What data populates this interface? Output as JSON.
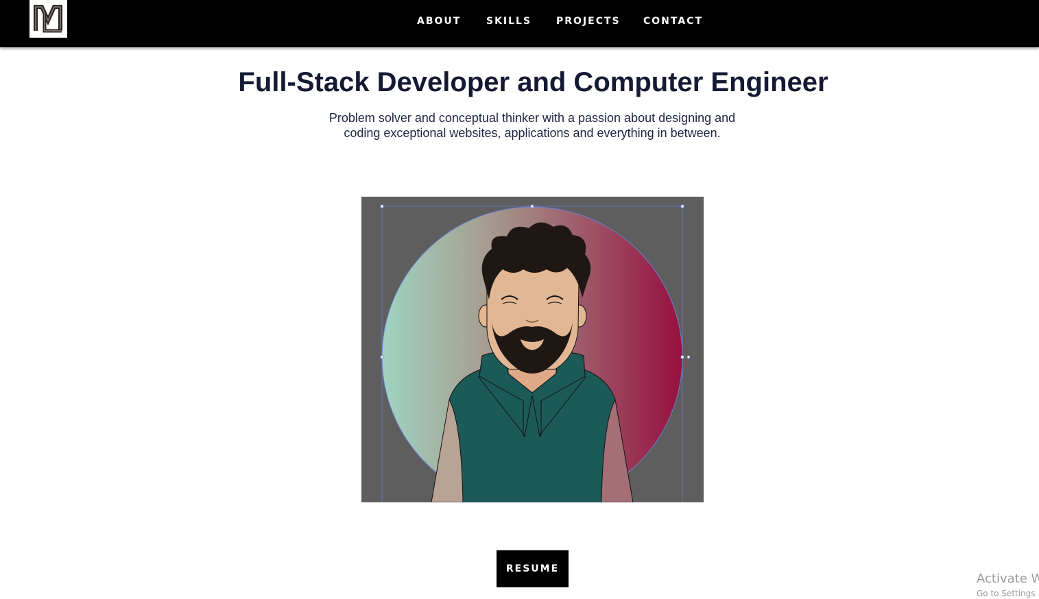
{
  "nav": {
    "logo_alt": "ML logo",
    "items": [
      {
        "label": "ABOUT"
      },
      {
        "label": "SKILLS"
      },
      {
        "label": "PROJECTS"
      },
      {
        "label": "CONTACT"
      }
    ]
  },
  "hero": {
    "title": "Full-Stack Developer and Computer Engineer",
    "subtitle_line1": "Problem solver and conceptual thinker with a passion about designing and",
    "subtitle_line2": "coding exceptional websites, applications and everything in between."
  },
  "avatar": {
    "icon": "avatar-illustration",
    "bg_color": "#5e5e5e",
    "gradient_left": "#9fd3c1",
    "gradient_right": "#970f3f",
    "hoodie_color": "#1c5a58",
    "skin_color": "#e2b793",
    "hair_color": "#1f1714"
  },
  "resume_button": {
    "label": "RESUME"
  },
  "watermark": {
    "line1": "Activate W",
    "line2": "Go to Settings"
  }
}
